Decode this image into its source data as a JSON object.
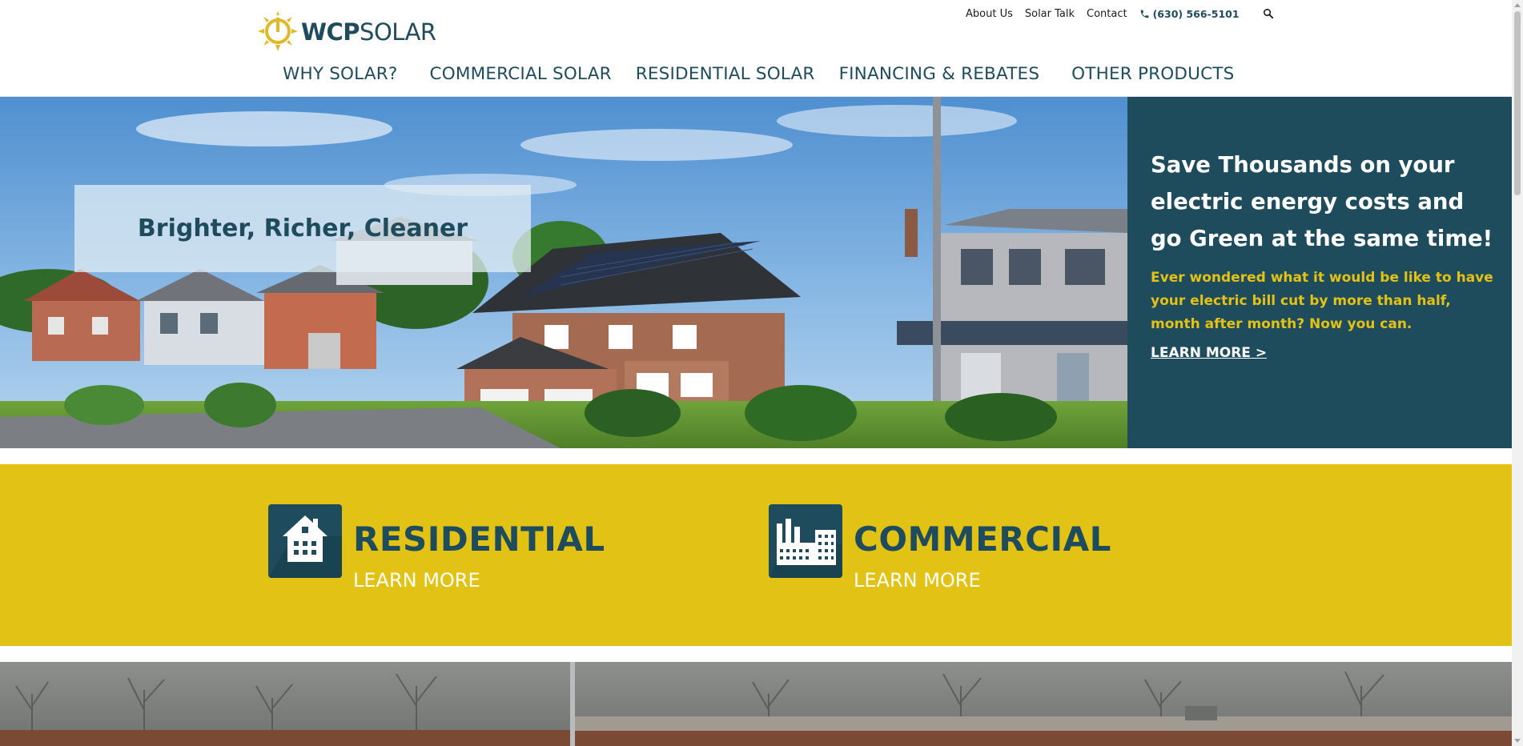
{
  "header": {
    "logo": {
      "wordmark_bold": "WCP",
      "wordmark_light": "SOLAR"
    },
    "utility_nav": [
      "About Us",
      "Solar Talk",
      "Contact"
    ],
    "phone": "(630) 566-5101",
    "main_nav": [
      "WHY SOLAR?",
      "COMMERCIAL SOLAR",
      "RESIDENTIAL SOLAR",
      "FINANCING & REBATES",
      "OTHER PRODUCTS"
    ]
  },
  "hero": {
    "tagline": "Brighter, Richer, Cleaner",
    "heading": "Save Thousands on your electric energy costs and go Green at the same time!",
    "subheading": "Ever wondered what it would be like to have your electric bill cut by more than half, month after month? Now you can.",
    "cta": "LEARN MORE >"
  },
  "cards": [
    {
      "title": "RESIDENTIAL",
      "link": "LEARN MORE",
      "icon": "house-icon"
    },
    {
      "title": "COMMERCIAL",
      "link": "LEARN MORE",
      "icon": "factory-icon"
    }
  ],
  "colors": {
    "brand_teal": "#1f4c5d",
    "brand_yellow": "#e2c315",
    "accent_yellow_text": "#e3c214",
    "white": "#ffffff"
  }
}
